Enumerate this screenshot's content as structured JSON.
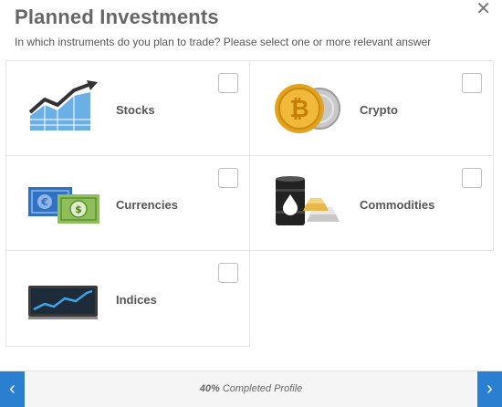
{
  "header": {
    "title": "Planned Investments",
    "subtitle": "In which instruments do you plan to trade? Please select one or more relevant answer",
    "close_icon": "close-icon",
    "close_glyph": "✕"
  },
  "options": [
    {
      "label": "Stocks",
      "icon": "stocks-chart-icon",
      "checked": false
    },
    {
      "label": "Crypto",
      "icon": "bitcoin-coins-icon",
      "checked": false
    },
    {
      "label": "Currencies",
      "icon": "currency-bills-icon",
      "checked": false
    },
    {
      "label": "Commodities",
      "icon": "oil-barrel-gold-icon",
      "checked": false
    },
    {
      "label": "Indices",
      "icon": "indices-monitor-icon",
      "checked": false
    }
  ],
  "footer": {
    "progress_value": "40%",
    "progress_text": "Completed Profile",
    "prev_glyph": "‹",
    "next_glyph": "›"
  },
  "colors": {
    "accent": "#2a7fd1",
    "stocks_blue": "#5fa3dc",
    "gold": "#e3a21b",
    "bill_green": "#8fbf5a",
    "bill_blue": "#2f72c5"
  }
}
